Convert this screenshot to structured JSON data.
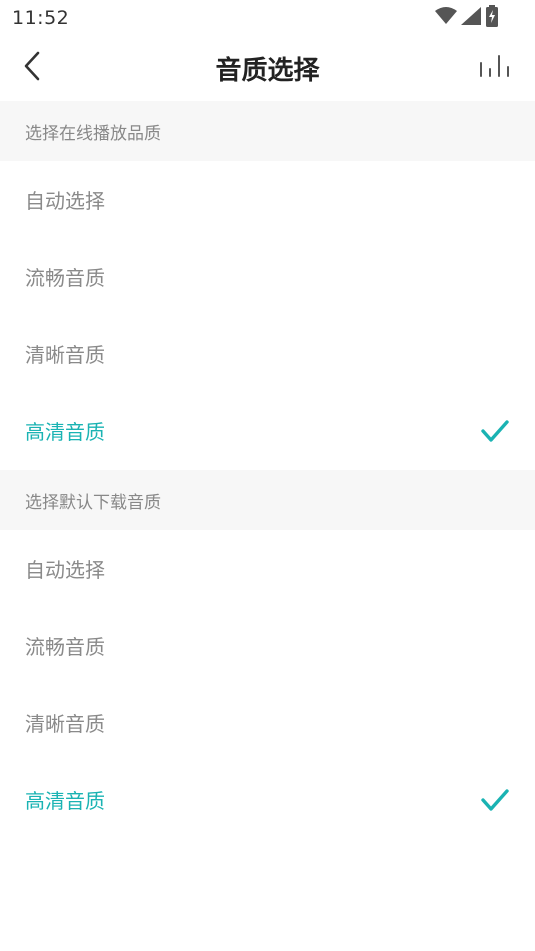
{
  "status_bar": {
    "time": "11:52",
    "icons": [
      "wifi-icon",
      "signal-icon",
      "battery-charging-icon"
    ]
  },
  "nav": {
    "back_icon": "chevron-left-icon",
    "title": "音质选择",
    "equalizer_icon": "equalizer-icon"
  },
  "accent_color": "#1ab3b3",
  "online": {
    "header": "选择在线播放品质",
    "options": [
      {
        "label": "自动选择",
        "selected": false
      },
      {
        "label": "流畅音质",
        "selected": false
      },
      {
        "label": "清晰音质",
        "selected": false
      },
      {
        "label": "高清音质",
        "selected": true
      }
    ]
  },
  "download": {
    "header": "选择默认下载音质",
    "options": [
      {
        "label": "自动选择",
        "selected": false
      },
      {
        "label": "流畅音质",
        "selected": false
      },
      {
        "label": "清晰音质",
        "selected": false
      },
      {
        "label": "高清音质",
        "selected": true
      }
    ]
  }
}
